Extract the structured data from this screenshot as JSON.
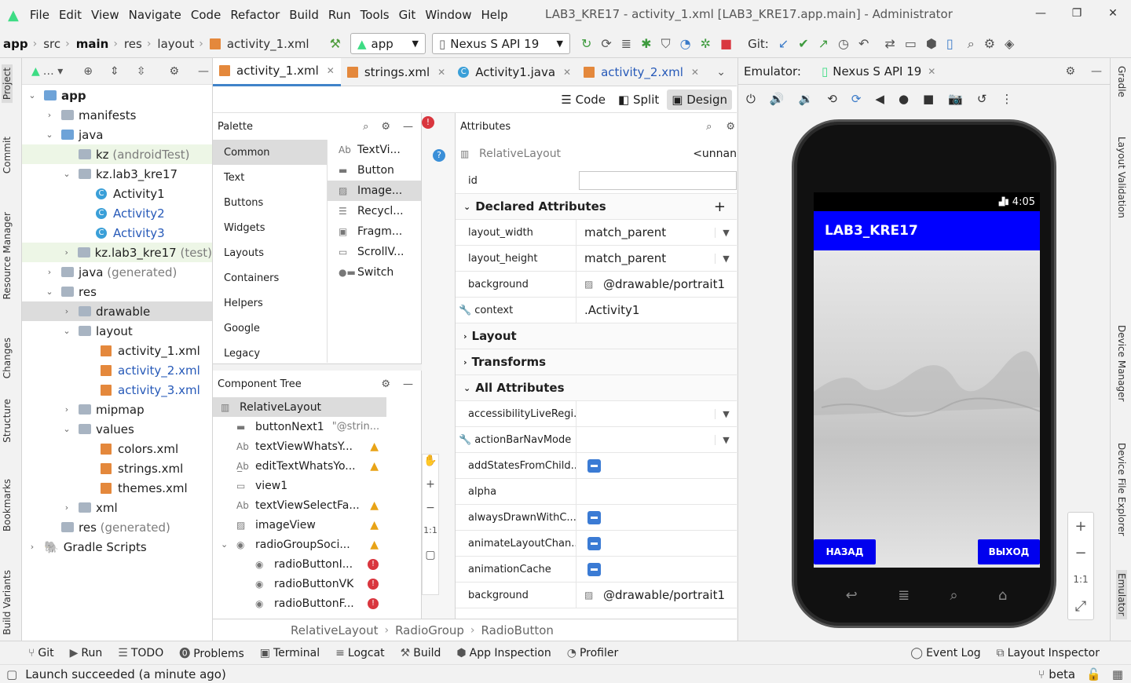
{
  "menu": {
    "items": [
      "File",
      "Edit",
      "View",
      "Navigate",
      "Code",
      "Refactor",
      "Build",
      "Run",
      "Tools",
      "Git",
      "Window",
      "Help"
    ],
    "window_title": "LAB3_KRE17 - activity_1.xml [LAB3_KRE17.app.main] - Administrator"
  },
  "nav": {
    "crumbs": [
      "app",
      "src",
      "main",
      "res",
      "layout",
      "activity_1.xml"
    ],
    "run_config": "app",
    "device": "Nexus S API 19",
    "git_label": "Git:"
  },
  "left_strip": [
    "Project",
    "Commit",
    "Resource Manager",
    "Changes",
    "Structure",
    "Bookmarks",
    "Build Variants"
  ],
  "right_strip": [
    "Gradle",
    "Layout Validation",
    "Device Manager",
    "Device File Explorer",
    "Emulator"
  ],
  "project": {
    "tree": [
      {
        "label": "app",
        "extra": ""
      },
      {
        "label": "manifests",
        "extra": ""
      },
      {
        "label": "java",
        "extra": ""
      },
      {
        "label": "kz",
        "extra": "(androidTest)"
      },
      {
        "label": "kz.lab3_kre17",
        "extra": ""
      },
      {
        "label": "Activity1",
        "extra": ""
      },
      {
        "label": "Activity2",
        "extra": ""
      },
      {
        "label": "Activity3",
        "extra": ""
      },
      {
        "label": "kz.lab3_kre17",
        "extra": "(test)"
      },
      {
        "label": "java",
        "extra": "(generated)"
      },
      {
        "label": "res",
        "extra": ""
      },
      {
        "label": "drawable",
        "extra": ""
      },
      {
        "label": "layout",
        "extra": ""
      },
      {
        "label": "activity_1.xml",
        "extra": ""
      },
      {
        "label": "activity_2.xml",
        "extra": ""
      },
      {
        "label": "activity_3.xml",
        "extra": ""
      },
      {
        "label": "mipmap",
        "extra": ""
      },
      {
        "label": "values",
        "extra": ""
      },
      {
        "label": "colors.xml",
        "extra": ""
      },
      {
        "label": "strings.xml",
        "extra": ""
      },
      {
        "label": "themes.xml",
        "extra": ""
      },
      {
        "label": "xml",
        "extra": ""
      },
      {
        "label": "res",
        "extra": "(generated)"
      },
      {
        "label": "Gradle Scripts",
        "extra": ""
      }
    ]
  },
  "editor": {
    "tabs": [
      "activity_1.xml",
      "strings.xml",
      "Activity1.java",
      "activity_2.xml"
    ],
    "view_modes": [
      "Code",
      "Split",
      "Design"
    ]
  },
  "palette": {
    "title": "Palette",
    "categories": [
      "Common",
      "Text",
      "Buttons",
      "Widgets",
      "Layouts",
      "Containers",
      "Helpers",
      "Google",
      "Legacy"
    ],
    "items": [
      "TextVi...",
      "Button",
      "Image...",
      "Recycl...",
      "Fragm...",
      "ScrollV...",
      "Switch"
    ]
  },
  "component_tree": {
    "title": "Component Tree",
    "items": [
      "RelativeLayout",
      "buttonNext1",
      "textViewWhatsY...",
      "editTextWhatsYo...",
      "view1",
      "textViewSelectFa...",
      "imageView",
      "radioGroupSoci...",
      "radioButtonI...",
      "radioButtonVK",
      "radioButtonF..."
    ],
    "button_hint": "\"@strin..."
  },
  "attributes": {
    "title": "Attributes",
    "widget": "RelativeLayout",
    "widget_id": "<unnan",
    "id_label": "id",
    "declared_title": "Declared Attributes",
    "declared": [
      {
        "name": "layout_width",
        "value": "match_parent"
      },
      {
        "name": "layout_height",
        "value": "match_parent"
      },
      {
        "name": "background",
        "value": "@drawable/portrait1"
      },
      {
        "name": "context",
        "value": ".Activity1"
      }
    ],
    "sections": [
      "Layout",
      "Transforms",
      "All Attributes"
    ],
    "all": [
      {
        "name": "accessibilityLiveRegi...",
        "value": ""
      },
      {
        "name": "actionBarNavMode",
        "value": ""
      },
      {
        "name": "addStatesFromChild...",
        "value": ""
      },
      {
        "name": "alpha",
        "value": ""
      },
      {
        "name": "alwaysDrawnWithC...",
        "value": ""
      },
      {
        "name": "animateLayoutChan...",
        "value": ""
      },
      {
        "name": "animationCache",
        "value": ""
      },
      {
        "name": "background",
        "value": "@drawable/portrait1"
      }
    ]
  },
  "breadcrumb": [
    "RelativeLayout",
    "RadioGroup",
    "RadioButton"
  ],
  "emulator": {
    "label": "Emulator:",
    "tab": "Nexus S API 19",
    "status_time": "4:05",
    "app_title": "LAB3_KRE17",
    "btn_back": "НАЗАД",
    "btn_exit": "ВЫХОД",
    "zoom": [
      "+",
      "−",
      "1:1",
      "⤢"
    ]
  },
  "toolwindows": [
    "Git",
    "Run",
    "TODO",
    "Problems",
    "Terminal",
    "Logcat",
    "Build",
    "App Inspection",
    "Profiler",
    "Event Log",
    "Layout Inspector"
  ],
  "status": {
    "message": "Launch succeeded (a minute ago)",
    "branch": "beta"
  }
}
